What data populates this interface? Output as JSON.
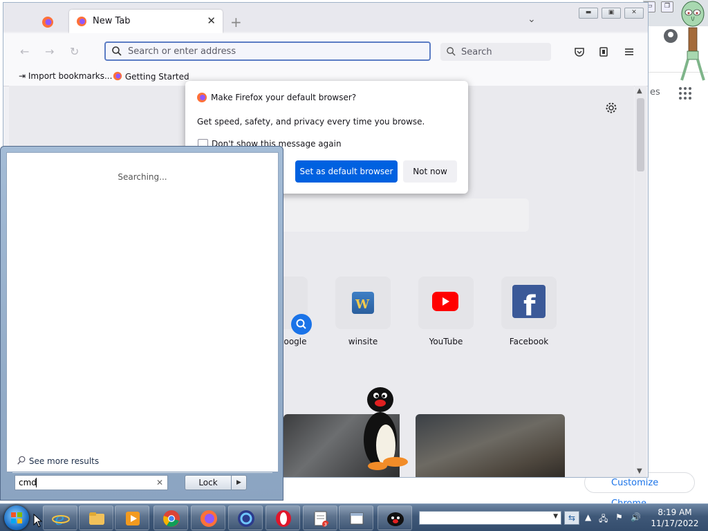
{
  "firefox": {
    "tab_title": "New Tab",
    "url_placeholder": "Search or enter address",
    "search_placeholder": "Search",
    "bookmarks": [
      "Import bookmarks...",
      "Getting Started"
    ]
  },
  "dialog": {
    "title": "Make Firefox your default browser?",
    "body": "Get speed, safety, and privacy every time you browse.",
    "checkbox": "Don't show this message again",
    "primary_button": "Set as default browser",
    "secondary_button": "Not now"
  },
  "tiles": [
    "oogle",
    "winsite",
    "YouTube",
    "Facebook"
  ],
  "start_menu": {
    "searching": "Searching...",
    "see_more": "See more results",
    "query": "cmd",
    "lock_label": "Lock"
  },
  "chrome": {
    "partial_text": "es",
    "customize": "Customize Chrome"
  },
  "clock": {
    "time": "8:19 AM",
    "date": "11/17/2022"
  },
  "taskbar": {
    "badge": "3"
  },
  "colors": {
    "primary_button": "#0061e0",
    "taskbar": "#3f5878",
    "youtube": "#ff0000",
    "facebook": "#3b5998"
  }
}
